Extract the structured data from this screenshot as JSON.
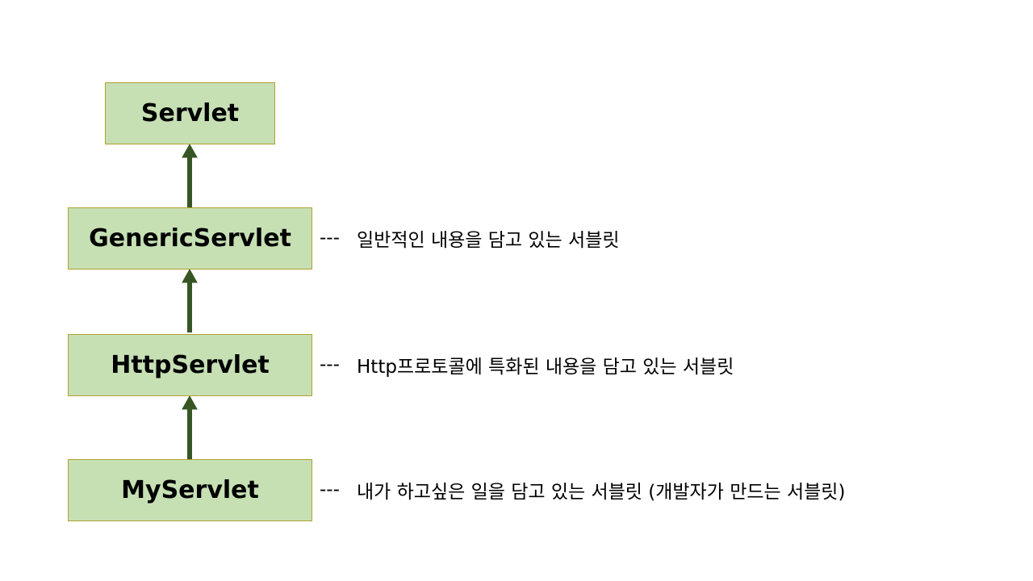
{
  "nodes": {
    "servlet": "Servlet",
    "generic_servlet": "GenericServlet",
    "http_servlet": "HttpServlet",
    "my_servlet": "MyServlet"
  },
  "descriptions": {
    "separator": "---",
    "generic_servlet": "일반적인 내용을 담고 있는 서블릿",
    "http_servlet": "Http프로토콜에 특화된 내용을 담고 있는 서블릿",
    "my_servlet": "내가 하고싶은 일을 담고 있는 서블릿 (개발자가 만드는 서블릿)"
  },
  "colors": {
    "box_fill": "#c6e0b4",
    "box_border": "#b0a030",
    "arrow": "#375623"
  }
}
